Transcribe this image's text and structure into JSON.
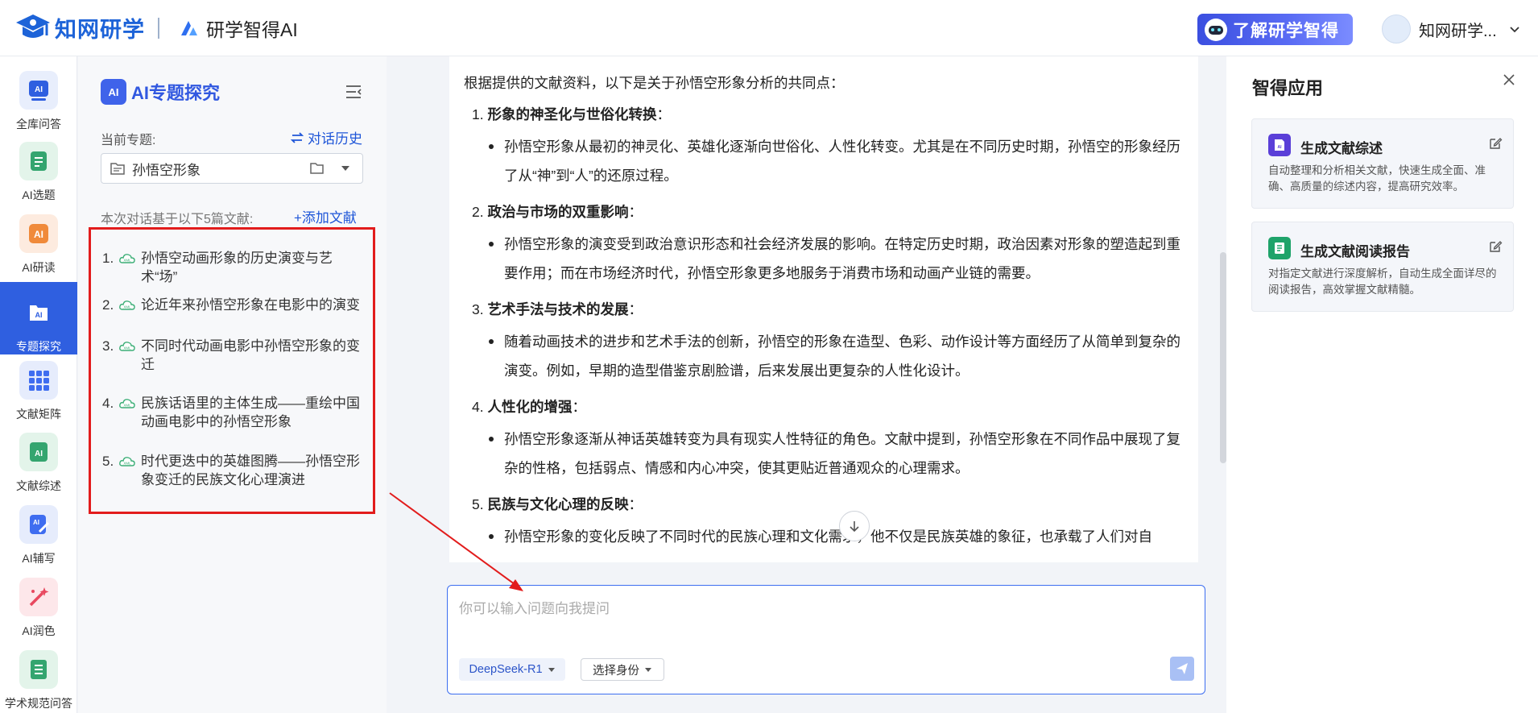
{
  "header": {
    "logo_text": "知网研学",
    "sub_logo_text": "研学智得AI",
    "promo_label": "了解研学智得",
    "user_name": "知网研学..."
  },
  "rail": {
    "items": [
      {
        "label": "全库问答",
        "icon": "ai-qa-icon",
        "badge": "AI"
      },
      {
        "label": "AI选题",
        "icon": "ai-topic-icon",
        "badge": ""
      },
      {
        "label": "AI研读",
        "icon": "ai-read-icon",
        "badge": "AI"
      },
      {
        "label": "专题探究",
        "icon": "topic-explore-icon",
        "badge": "AI",
        "active": true
      },
      {
        "label": "文献矩阵",
        "icon": "matrix-icon",
        "badge": ""
      },
      {
        "label": "文献综述",
        "icon": "review-icon",
        "badge": "AI"
      },
      {
        "label": "AI辅写",
        "icon": "ai-write-icon",
        "badge": "AI"
      },
      {
        "label": "AI润色",
        "icon": "ai-polish-icon",
        "badge": ""
      },
      {
        "label": "学术规范问答",
        "icon": "norm-qa-icon",
        "badge": ""
      }
    ]
  },
  "panel": {
    "title": "AI专题探究",
    "current_topic_label": "当前专题:",
    "history_label": "对话历史",
    "topic_value": "孙悟空形象",
    "refs_label": "本次对话基于以下5篇文献:",
    "add_ref_label": "+添加文献",
    "refs": [
      {
        "num": "1.",
        "title": "孙悟空动画形象的历史演变与艺术“场”"
      },
      {
        "num": "2.",
        "title": "论近年来孙悟空形象在电影中的演变"
      },
      {
        "num": "3.",
        "title": "不同时代动画电影中孙悟空形象的变迁"
      },
      {
        "num": "4.",
        "title": "民族话语里的主体生成——重绘中国动画电影中的孙悟空形象"
      },
      {
        "num": "5.",
        "title": "时代更迭中的英雄图腾——孙悟空形象变迁的民族文化心理演进"
      }
    ]
  },
  "chat": {
    "intro": "根据提供的文献资料，以下是关于孙悟空形象分析的共同点：",
    "sections": [
      {
        "num": "1.",
        "title": "形象的神圣化与世俗化转换",
        "colon": "：",
        "body": "孙悟空形象从最初的神灵化、英雄化逐渐向世俗化、人性化转变。尤其是在不同历史时期，孙悟空的形象经历了从“神”到“人”的还原过程。"
      },
      {
        "num": "2.",
        "title": "政治与市场的双重影响",
        "colon": "：",
        "body": "孙悟空形象的演变受到政治意识形态和社会经济发展的影响。在特定历史时期，政治因素对形象的塑造起到重要作用；而在市场经济时代，孙悟空形象更多地服务于消费市场和动画产业链的需要。"
      },
      {
        "num": "3.",
        "title": "艺术手法与技术的发展",
        "colon": "：",
        "body": "随着动画技术的进步和艺术手法的创新，孙悟空的形象在造型、色彩、动作设计等方面经历了从简单到复杂的演变。例如，早期的造型借鉴京剧脸谱，后来发展出更复杂的人性化设计。"
      },
      {
        "num": "4.",
        "title": "人性化的增强",
        "colon": "：",
        "body": "孙悟空形象逐渐从神话英雄转变为具有现实人性特征的角色。文献中提到，孙悟空形象在不同作品中展现了复杂的性格，包括弱点、情感和内心冲突，使其更贴近普通观众的心理需求。"
      },
      {
        "num": "5.",
        "title": "民族与文化心理的反映",
        "colon": "：",
        "body": "孙悟空形象的变化反映了不同时代的民族心理和文化需求，他不仅是民族英雄的象征，也承载了人们对自"
      }
    ],
    "input_placeholder": "你可以输入问题向我提问",
    "model_label": "DeepSeek-R1",
    "role_label": "选择身份"
  },
  "apps": {
    "title": "智得应用",
    "cards": [
      {
        "name": "生成文献综述",
        "desc": "自动整理和分析相关文献，快速生成全面、准确、高质量的综述内容，提高研究效率。",
        "icon": "review-gen-icon",
        "color": "#5a3fd8"
      },
      {
        "name": "生成文献阅读报告",
        "desc": "对指定文献进行深度解析，自动生成全面详尽的阅读报告，高效掌握文献精髓。",
        "icon": "report-gen-icon",
        "color": "#1fa36a"
      }
    ]
  },
  "colors": {
    "brand": "#1d63d8",
    "active_rail": "#2f5fe0",
    "highlight_border": "#e21c1c",
    "arrow": "#e21c1c"
  }
}
